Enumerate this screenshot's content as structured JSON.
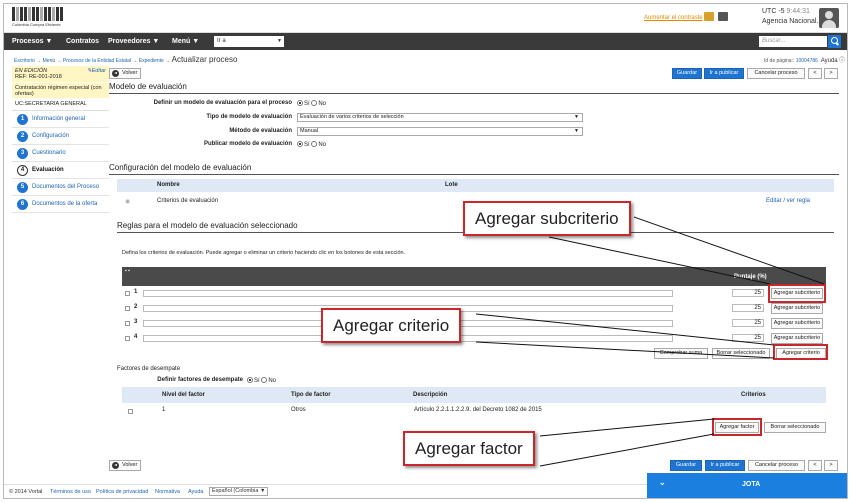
{
  "header": {
    "logo_text": "Colombia Compra Eficiente",
    "contrast_link": "Aumentar el contraste",
    "utc_label": "UTC -5",
    "time": "9:44:31",
    "entity": "Agencia Nacional..."
  },
  "nav": {
    "items": [
      "Procesos ▼",
      "Contratos",
      "Proveedores ▼",
      "Menú ▼"
    ],
    "goto_value": "Ir a",
    "search_placeholder": "Buscar..."
  },
  "breadcrumb": {
    "items": [
      "Escritorio",
      "Menú",
      "Procesos de la Entidad Estatal",
      "Expediente"
    ],
    "current": "Actualizar proceso"
  },
  "page_id": {
    "label": "Id de página::",
    "value": "10004786",
    "help": "Ayuda"
  },
  "sidebar": {
    "status": "EN EDICIÓN",
    "ref": "REF: RE-001-2018",
    "edit": "Editar",
    "type": "Contratación régimen especial (con ofertas)",
    "uc": "UC:SECRETARIA GENERAL",
    "steps": [
      {
        "num": "1",
        "label": "Información general"
      },
      {
        "num": "2",
        "label": "Configuración"
      },
      {
        "num": "3",
        "label": "Cuestionario"
      },
      {
        "num": "4",
        "label": "Evaluación"
      },
      {
        "num": "5",
        "label": "Documentos del Proceso"
      },
      {
        "num": "6",
        "label": "Documentos de la oferta"
      }
    ]
  },
  "toolbar": {
    "volver": "Volver",
    "guardar": "Guardar",
    "publicar": "Ir a publicar",
    "cancelar": "Cancelar proceso",
    "prev": "<",
    "next": ">"
  },
  "modelo": {
    "title": "Modelo de evaluación",
    "q_definir": "Definir un modelo de evaluación para el proceso",
    "q_tipo": "Tipo de modelo de evaluación",
    "tipo_value": "Evaluación de varios criterios de selección",
    "q_metodo": "Método de evaluación",
    "metodo_value": "Manual",
    "q_publicar": "Publicar modelo de evaluación",
    "si": "Sí",
    "no": "No"
  },
  "config": {
    "title": "Configuración del modelo de evaluación",
    "col_nombre": "Nombre",
    "col_lote": "Lote",
    "row_nombre": "Criterios de evaluación",
    "row_action": "Editar / ver regla"
  },
  "reglas": {
    "title": "Reglas para el modelo de evaluación seleccionado",
    "desc": "Defina los criterios de evaluación. Puede agregar o eliminar un criterio haciendo clic en los botones de esta sección.",
    "col_puntaje": "Puntaje (%)",
    "rows": [
      {
        "num": "1",
        "score": "25",
        "action": "Agregar subcriterio"
      },
      {
        "num": "2",
        "score": "25",
        "action": "Agregar subcriterio"
      },
      {
        "num": "3",
        "score": "25",
        "action": "Agregar subcriterio"
      },
      {
        "num": "4",
        "score": "25",
        "action": "Agregar subcriterio"
      }
    ],
    "btn_comprobar": "Comprobar suma",
    "btn_borrar": "Borrar seleccionado",
    "btn_agregar": "Agregar criterio"
  },
  "factores": {
    "title": "Factores de desempate",
    "q_definir": "Definir factores de desempate",
    "col_nivel": "Nivel del factor",
    "col_tipo": "Tipo de factor",
    "col_desc": "Descripción",
    "col_criterios": "Criterios",
    "row": {
      "nivel": "1",
      "tipo": "Otros",
      "desc": "Artículo 2.2.1.1.2.2.9. del Decreto 1082 de 2015"
    },
    "btn_agregar": "Agregar factor",
    "btn_borrar": "Borrar seleccionado"
  },
  "callouts": {
    "subcriterio": "Agregar subcriterio",
    "criterio": "Agregar criterio",
    "factor": "Agregar factor"
  },
  "footer": {
    "copyright": "© 2014 Vortal",
    "terms": "Términos de uso",
    "privacy": "Política de privacidad",
    "normativa": "Normativa",
    "ayuda": "Ayuda",
    "lang": "Español (Colombia ▼"
  },
  "chat": {
    "label": "JOTA"
  },
  "colors": {
    "accent": "#1e74d0",
    "callout_border": "#c9272c",
    "nav_bg": "#3a3a3a"
  }
}
